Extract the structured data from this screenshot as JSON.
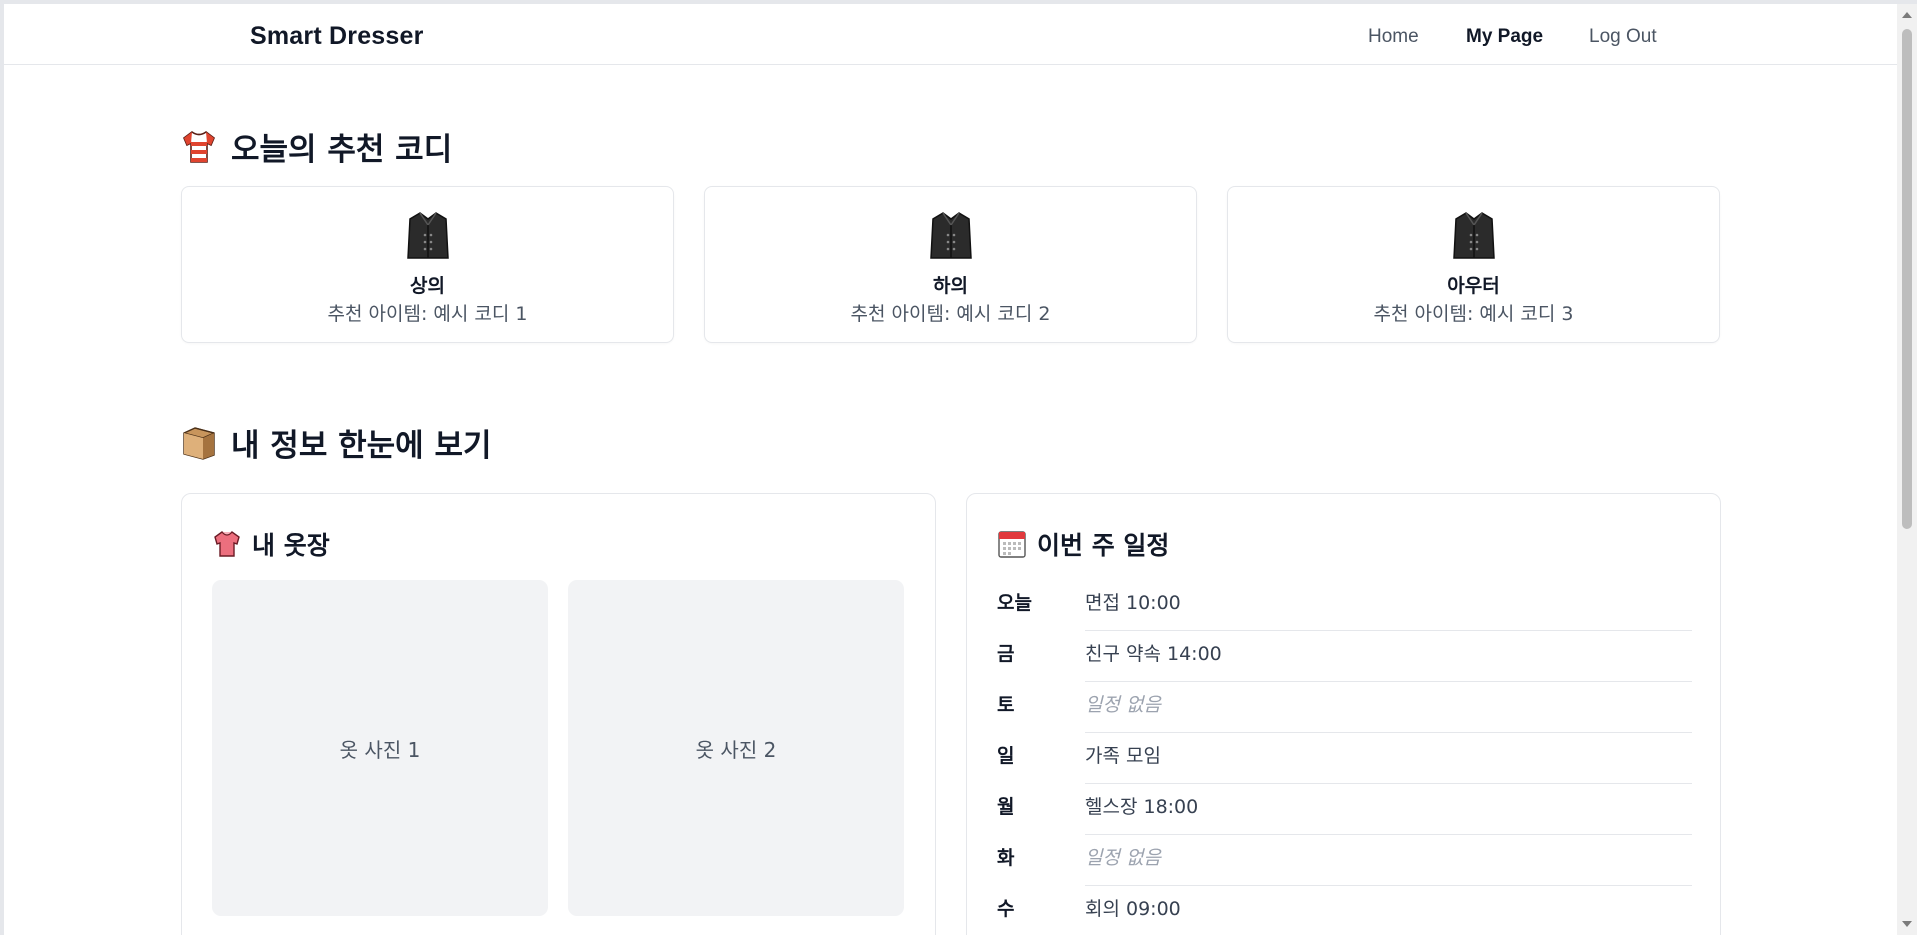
{
  "header": {
    "brand": "Smart Dresser",
    "nav": [
      {
        "label": "Home",
        "active": false
      },
      {
        "label": "My Page",
        "active": true
      },
      {
        "label": "Log Out",
        "active": false
      }
    ]
  },
  "recommend": {
    "title": "오늘의 추천 코디",
    "icon": "shirt-icon",
    "cards": [
      {
        "category": "상의",
        "item": "추천 아이템: 예시 코디 1",
        "icon": "coat-icon"
      },
      {
        "category": "하의",
        "item": "추천 아이템: 예시 코디 2",
        "icon": "coat-icon"
      },
      {
        "category": "아우터",
        "item": "추천 아이템: 예시 코디 3",
        "icon": "coat-icon"
      }
    ]
  },
  "overview": {
    "title": "내 정보 한눈에 보기",
    "icon": "package-icon",
    "closet": {
      "title": "내 옷장",
      "icon": "blouse-icon",
      "photos": [
        "옷 사진 1",
        "옷 사진 2"
      ]
    },
    "schedule": {
      "title": "이번 주 일정",
      "icon": "calendar-icon",
      "rows": [
        {
          "day": "오늘",
          "text": "면접 10:00",
          "empty": false
        },
        {
          "day": "금",
          "text": "친구 약속 14:00",
          "empty": false
        },
        {
          "day": "토",
          "text": "일정 없음",
          "empty": true
        },
        {
          "day": "일",
          "text": "가족 모임",
          "empty": false
        },
        {
          "day": "월",
          "text": "헬스장 18:00",
          "empty": false
        },
        {
          "day": "화",
          "text": "일정 없음",
          "empty": true
        },
        {
          "day": "수",
          "text": "회의 09:00",
          "empty": false
        }
      ]
    }
  },
  "colors": {
    "text": "#111827",
    "muted": "#4b5563",
    "border": "#e5e7eb",
    "photo_bg": "#f2f3f5",
    "empty_text": "#9ca3af"
  }
}
